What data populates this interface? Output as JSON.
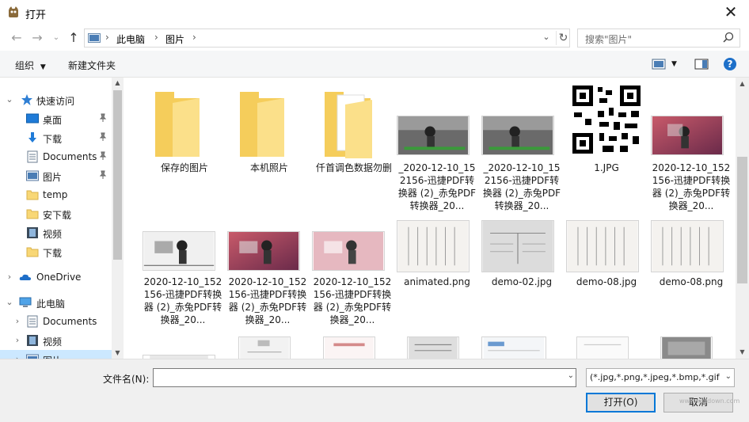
{
  "window": {
    "title": "打开"
  },
  "nav": {
    "breadcrumbs": [
      "此电脑",
      "图片"
    ],
    "search_placeholder": "搜索\"图片\""
  },
  "toolbar": {
    "organize": "组织",
    "new_folder": "新建文件夹"
  },
  "sidebar": {
    "items": [
      {
        "label": "快速访问",
        "icon": "star-icon"
      },
      {
        "label": "桌面",
        "icon": "desktop-icon"
      },
      {
        "label": "下载",
        "icon": "download-icon"
      },
      {
        "label": "Documents",
        "icon": "document-icon"
      },
      {
        "label": "图片",
        "icon": "pictures-icon"
      },
      {
        "label": "temp",
        "icon": "folder-icon"
      },
      {
        "label": "安下载",
        "icon": "folder-icon"
      },
      {
        "label": "视频",
        "icon": "video-icon"
      },
      {
        "label": "下载",
        "icon": "folder-icon"
      },
      {
        "label": "OneDrive",
        "icon": "cloud-icon"
      },
      {
        "label": "此电脑",
        "icon": "computer-icon"
      },
      {
        "label": "Documents",
        "icon": "document-icon"
      },
      {
        "label": "视频",
        "icon": "video-icon"
      },
      {
        "label": "图片",
        "icon": "pictures-icon"
      }
    ]
  },
  "files": [
    {
      "name": "保存的图片",
      "type": "folder"
    },
    {
      "name": "本机照片",
      "type": "folder"
    },
    {
      "name": "仟首调色数据勿删",
      "type": "folder-docs"
    },
    {
      "name": "_2020-12-10_152156-迅捷PDF转换器 (2)_赤兔PDF转换器_20...",
      "type": "image-gray"
    },
    {
      "name": "_2020-12-10_152156-迅捷PDF转换器 (2)_赤兔PDF转换器_20...",
      "type": "image-gray"
    },
    {
      "name": "1.JPG",
      "type": "qr"
    },
    {
      "name": "2020-12-10_152156-迅捷PDF转换器 (2)_赤兔PDF转换器_20...",
      "type": "image-red"
    },
    {
      "name": "2020-12-10_152156-迅捷PDF转换器 (2)_赤兔PDF转换器_20...",
      "type": "image-bw"
    },
    {
      "name": "2020-12-10_152156-迅捷PDF转换器 (2)_赤兔PDF转换器_20...",
      "type": "image-red"
    },
    {
      "name": "2020-12-10_152156-迅捷PDF转换器 (2)_赤兔PDF转换器_20...",
      "type": "image-pink"
    },
    {
      "name": "animated.png",
      "type": "doc"
    },
    {
      "name": "demo-02.jpg",
      "type": "doc-gray"
    },
    {
      "name": "demo-08.jpg",
      "type": "doc"
    },
    {
      "name": "demo-08.png",
      "type": "doc"
    }
  ],
  "bottom": {
    "filename_label": "文件名(N):",
    "filename_value": "",
    "filetype": "(*.jpg,*.png,*.jpeg,*.bmp,*.gif",
    "open_button": "打开(O)",
    "cancel_button": "取消",
    "watermark": "www.weidown.com"
  },
  "colors": {
    "accent": "#0078d7",
    "selection": "#cce8ff",
    "folder": "#f8d775"
  }
}
